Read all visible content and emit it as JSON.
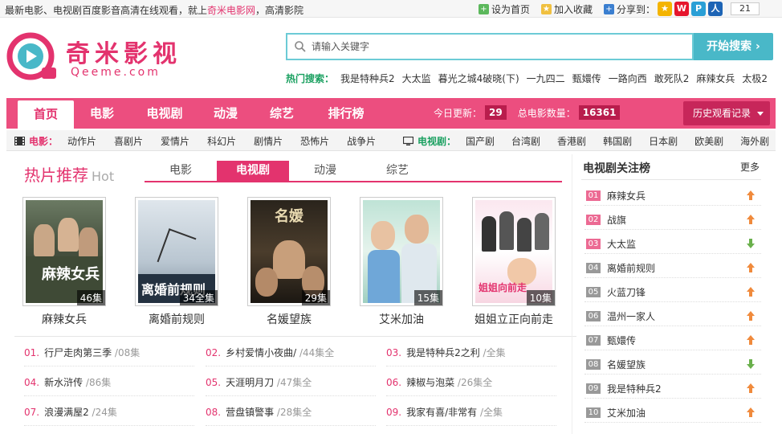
{
  "topbar": {
    "intro": "最新电影、电视剧百度影音高清在线观看，就上",
    "site_link": "奇米电影网",
    "intro_tail": "，高清影院",
    "set_home": "设为首页",
    "favorite": "加入收藏",
    "share_label": "分享到：",
    "share_count": "21"
  },
  "header": {
    "logo_title": "奇米影视",
    "logo_subtitle": "Qeeme.com",
    "search_placeholder": "请输入关键字",
    "search_button": "开始搜索 ›",
    "hot_label": "热门搜索：",
    "hot_keywords": [
      "我是特种兵2",
      "大太监",
      "暮光之城4破晓(下)",
      "一九四二",
      "甄嬛传",
      "一路向西",
      "敢死队2",
      "麻辣女兵",
      "太极2"
    ]
  },
  "nav": {
    "items": [
      "首页",
      "电影",
      "电视剧",
      "动漫",
      "综艺",
      "排行榜"
    ],
    "active": 0,
    "today_label": "今日更新：",
    "today_count": "29",
    "total_label": "总电影数量：",
    "total_count": "16361",
    "history": "历史观看记录"
  },
  "subnav": {
    "movie_label": "电影：",
    "movie_genres": [
      "动作片",
      "喜剧片",
      "爱情片",
      "科幻片",
      "剧情片",
      "恐怖片",
      "战争片"
    ],
    "tv_label": "电视剧：",
    "tv_genres": [
      "国产剧",
      "台湾剧",
      "香港剧",
      "韩国剧",
      "日本剧",
      "欧美剧",
      "海外剧"
    ]
  },
  "hot": {
    "title": "热片推荐",
    "title_en": "Hot",
    "tabs": [
      "电影",
      "电视剧",
      "动漫",
      "综艺"
    ],
    "active_tab": 1,
    "posters": [
      {
        "title": "麻辣女兵",
        "episodes": "46集"
      },
      {
        "title": "离婚前规则",
        "episodes": "34全集"
      },
      {
        "title": "名媛望族",
        "episodes": "29集"
      },
      {
        "title": "艾米加油",
        "episodes": "15集"
      },
      {
        "title": "姐姐立正向前走",
        "episodes": "10集"
      }
    ],
    "list": [
      {
        "idx": "01.",
        "title": "行尸走肉第三季",
        "status": " /08集"
      },
      {
        "idx": "02.",
        "title": "乡村爱情小夜曲/",
        "status": " /44集全"
      },
      {
        "idx": "03.",
        "title": "我是特种兵2之利",
        "status": " /全集"
      },
      {
        "idx": "04.",
        "title": "新水浒传",
        "status": " /86集"
      },
      {
        "idx": "05.",
        "title": "天涯明月刀",
        "status": " /47集全"
      },
      {
        "idx": "06.",
        "title": "辣椒与泡菜",
        "status": " /26集全"
      },
      {
        "idx": "07.",
        "title": "浪漫满屋2",
        "status": " /24集"
      },
      {
        "idx": "08.",
        "title": "营盘镇警事",
        "status": " /28集全"
      },
      {
        "idx": "09.",
        "title": "我家有喜/非常有",
        "status": " /全集"
      }
    ]
  },
  "ranking": {
    "title": "电视剧关注榜",
    "more": "更多",
    "items": [
      {
        "num": "01",
        "name": "麻辣女兵",
        "trend": "up"
      },
      {
        "num": "02",
        "name": "战旗",
        "trend": "up"
      },
      {
        "num": "03",
        "name": "大太监",
        "trend": "down"
      },
      {
        "num": "04",
        "name": "离婚前规则",
        "trend": "up"
      },
      {
        "num": "05",
        "name": "火蓝刀锋",
        "trend": "up"
      },
      {
        "num": "06",
        "name": "温州一家人",
        "trend": "up"
      },
      {
        "num": "07",
        "name": "甄嬛传",
        "trend": "up"
      },
      {
        "num": "08",
        "name": "名媛望族",
        "trend": "down"
      },
      {
        "num": "09",
        "name": "我是特种兵2",
        "trend": "up"
      },
      {
        "num": "10",
        "name": "艾米加油",
        "trend": "up"
      }
    ]
  },
  "colors": {
    "brand_pink": "#e3336e",
    "nav_pink": "#ec4e7f",
    "search_teal": "#49b8c8",
    "hot_green": "#1aa060",
    "up_orange": "#f08a3c",
    "down_green": "#6ab04c"
  }
}
